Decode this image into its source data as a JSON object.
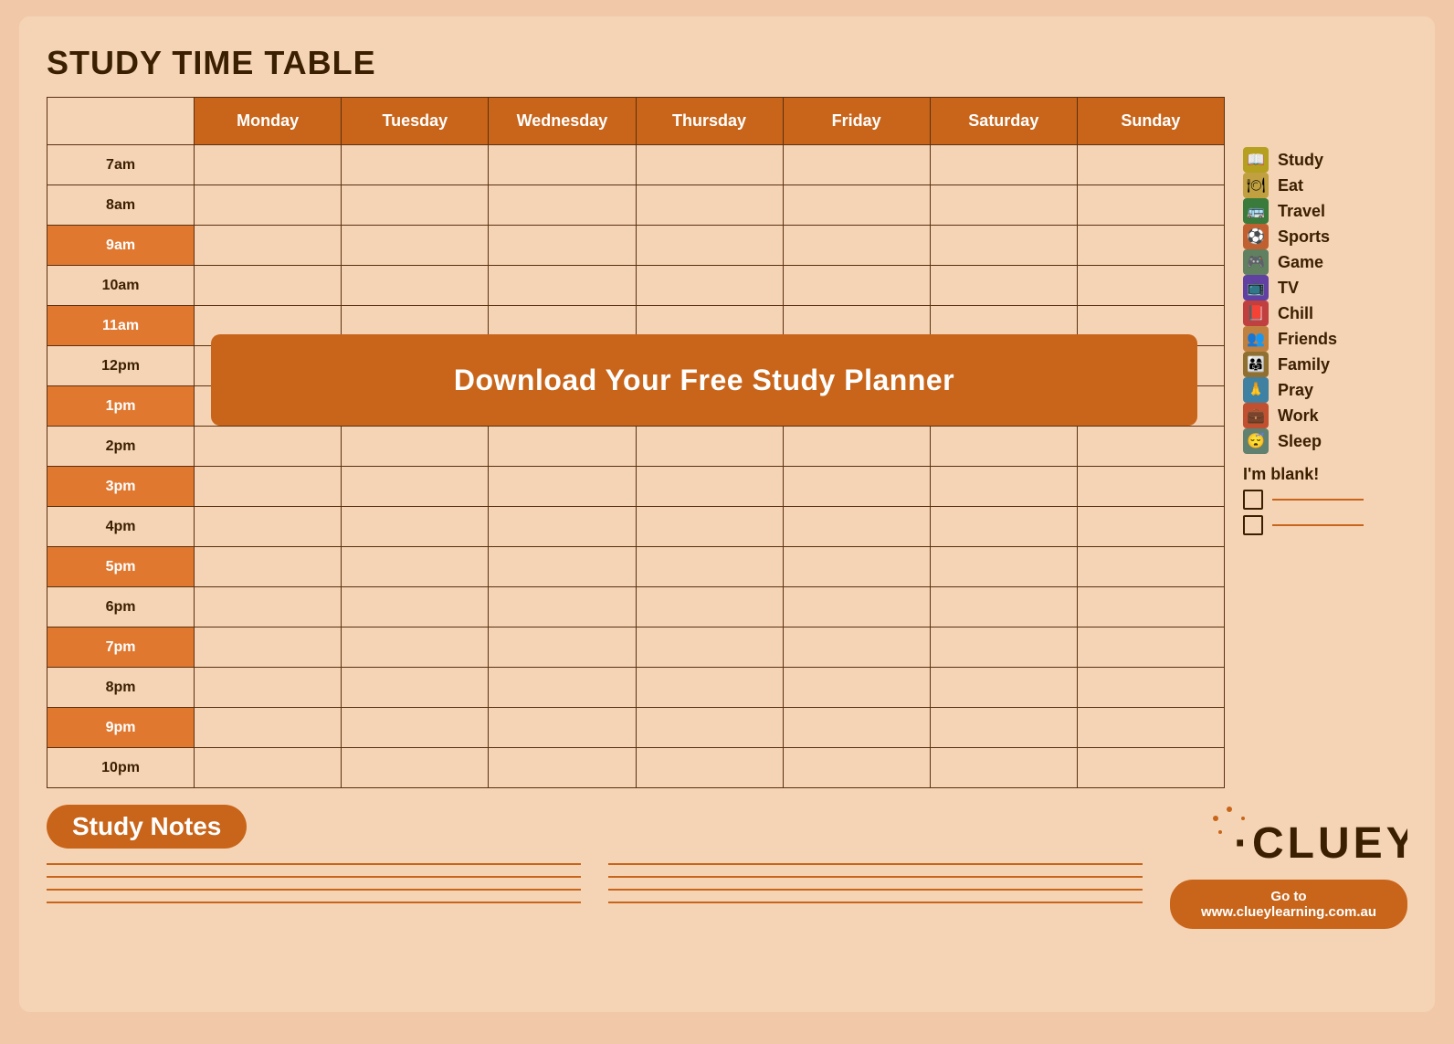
{
  "title": "STUDY TIME TABLE",
  "days": [
    "",
    "Monday",
    "Tuesday",
    "Wednesday",
    "Thursday",
    "Friday",
    "Saturday",
    "Sunday"
  ],
  "times": [
    {
      "label": "7am",
      "highlight": false
    },
    {
      "label": "8am",
      "highlight": false
    },
    {
      "label": "9am",
      "highlight": true
    },
    {
      "label": "10am",
      "highlight": false
    },
    {
      "label": "11am",
      "highlight": true
    },
    {
      "label": "12pm",
      "highlight": false
    },
    {
      "label": "1pm",
      "highlight": true
    },
    {
      "label": "2pm",
      "highlight": false
    },
    {
      "label": "3pm",
      "highlight": true
    },
    {
      "label": "4pm",
      "highlight": false
    },
    {
      "label": "5pm",
      "highlight": true
    },
    {
      "label": "6pm",
      "highlight": false
    },
    {
      "label": "7pm",
      "highlight": true
    },
    {
      "label": "8pm",
      "highlight": false
    },
    {
      "label": "9pm",
      "highlight": true
    },
    {
      "label": "10pm",
      "highlight": false
    }
  ],
  "legend": [
    {
      "key": "study",
      "icon": "📖",
      "label": "Study",
      "color": "icon-study"
    },
    {
      "key": "eat",
      "icon": "🍽",
      "label": "Eat",
      "color": "icon-eat"
    },
    {
      "key": "travel",
      "icon": "🚌",
      "label": "Travel",
      "color": "icon-travel"
    },
    {
      "key": "sports",
      "icon": "⚽",
      "label": "Sports",
      "color": "icon-sports"
    },
    {
      "key": "game",
      "icon": "🎮",
      "label": "Game",
      "color": "icon-game"
    },
    {
      "key": "tv",
      "icon": "📺",
      "label": "TV",
      "color": "icon-tv"
    },
    {
      "key": "chill",
      "icon": "📕",
      "label": "Chill",
      "color": "icon-chill"
    },
    {
      "key": "friends",
      "icon": "👥",
      "label": "Friends",
      "color": "icon-friends"
    },
    {
      "key": "family",
      "icon": "👨‍👩‍👧",
      "label": "Family",
      "color": "icon-family"
    },
    {
      "key": "pray",
      "icon": "🙏",
      "label": "Pray",
      "color": "icon-pray"
    },
    {
      "key": "work",
      "icon": "💼",
      "label": "Work",
      "color": "icon-work"
    },
    {
      "key": "sleep",
      "icon": "😴",
      "label": "Sleep",
      "color": "icon-sleep"
    }
  ],
  "blank_label": "I'm blank!",
  "download_button": "Download Your Free Study Planner",
  "study_notes_label": "Study Notes",
  "cluey_logo": "CLUEY",
  "website": "Go to www.clueylearning.com.au"
}
